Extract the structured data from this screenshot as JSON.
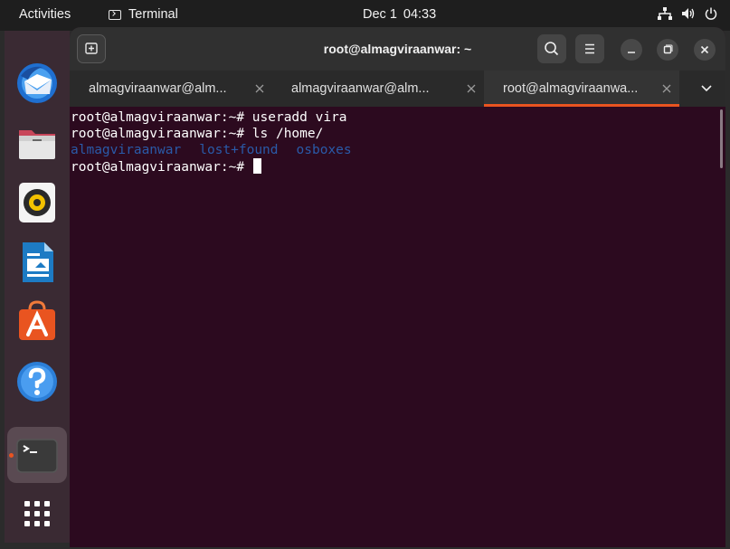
{
  "topbar": {
    "activities_label": "Activities",
    "app_name": "Terminal",
    "date": "Dec 1",
    "time": "04:33",
    "tray_icons": [
      "network-icon",
      "volume-icon",
      "power-icon"
    ]
  },
  "dock": {
    "items": [
      {
        "name": "thunderbird",
        "icon": "mail-client-icon"
      },
      {
        "name": "files",
        "icon": "folder-icon"
      },
      {
        "name": "rhythmbox",
        "icon": "music-player-icon"
      },
      {
        "name": "libreoffice-writer",
        "icon": "document-icon"
      },
      {
        "name": "ubuntu-software",
        "icon": "software-store-icon"
      },
      {
        "name": "help",
        "icon": "help-icon"
      },
      {
        "name": "terminal",
        "icon": "terminal-icon",
        "active": true
      },
      {
        "name": "show-applications",
        "icon": "app-grid-icon"
      }
    ]
  },
  "window": {
    "title": "root@almagviraanwar: ~",
    "tabs": [
      {
        "label": "almagviraanwar@alm...",
        "active": false
      },
      {
        "label": "almagviraanwar@alm...",
        "active": false
      },
      {
        "label": "root@almagviraanwa...",
        "active": true
      }
    ]
  },
  "terminal": {
    "lines": [
      "root@almagviraanwar:~# useradd vira",
      "root@almagviraanwar:~# ls /home/",
      "",
      "root@almagviraanwar:~# "
    ],
    "dir_listing": [
      "almagviraanwar",
      "lost+found",
      "osboxes"
    ]
  },
  "colors": {
    "accent": "#e95420",
    "terminal_bg": "#2c0a1f",
    "directory_text": "#2a5aa8"
  }
}
